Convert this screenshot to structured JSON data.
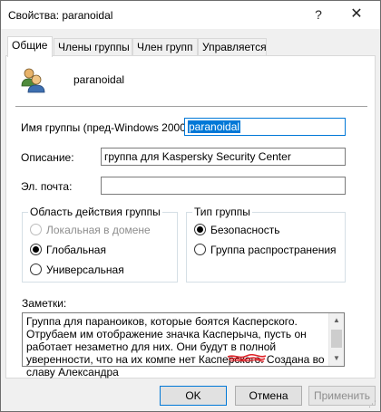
{
  "window": {
    "title": "Свойства: paranoidal",
    "help_glyph": "?",
    "close_glyph": "✕"
  },
  "tabs": [
    {
      "label": "Общие",
      "active": true
    },
    {
      "label": "Члены группы",
      "active": false
    },
    {
      "label": "Член групп",
      "active": false
    },
    {
      "label": "Управляется",
      "active": false
    }
  ],
  "general": {
    "group_name": "paranoidal",
    "pre2000_label": "Имя группы (пред-Windows 2000):",
    "pre2000_value": "paranoidal",
    "description_label": "Описание:",
    "description_value": "группа для Kaspersky Security Center",
    "email_label": "Эл. почта:",
    "email_value": ""
  },
  "scope": {
    "title": "Область действия группы",
    "options": [
      {
        "label": "Локальная в домене",
        "checked": false,
        "disabled": true
      },
      {
        "label": "Глобальная",
        "checked": true,
        "disabled": false
      },
      {
        "label": "Универсальная",
        "checked": false,
        "disabled": false
      }
    ]
  },
  "type": {
    "title": "Тип группы",
    "options": [
      {
        "label": "Безопасность",
        "checked": true,
        "disabled": false
      },
      {
        "label": "Группа распространения",
        "checked": false,
        "disabled": false
      }
    ]
  },
  "notes": {
    "label": "Заметки:",
    "text": "Группа для параноиков, которые боятся Касперского. Отрубаем им отображение значка Касперыча, пусть он работает незаметно для них. Они будут в полной уверенности, что на их компе нет Касперского. Создана во славу         Александра"
  },
  "buttons": {
    "ok": "OK",
    "cancel": "Отмена",
    "apply": "Применить"
  },
  "colors": {
    "accent": "#0078d7",
    "redaction": "#e0242a"
  }
}
